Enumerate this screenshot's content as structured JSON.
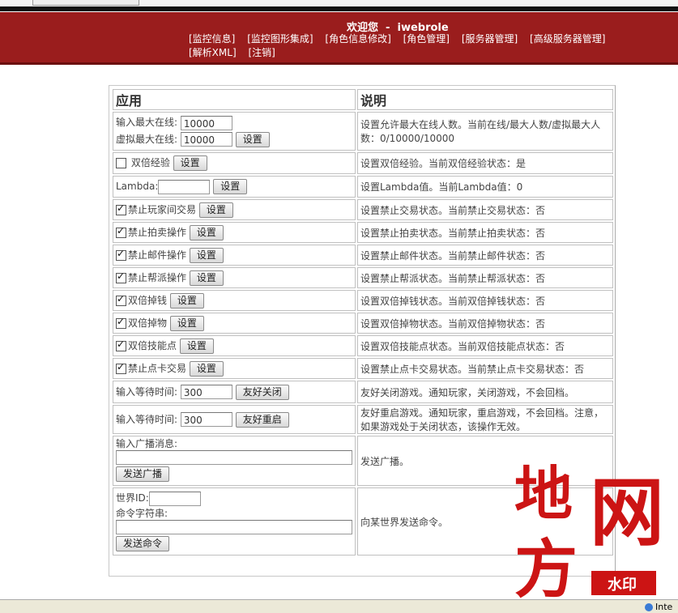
{
  "header": {
    "welcome": "欢迎您  -  iwebrole",
    "nav": [
      "[监控信息]",
      "[监控图形集成]",
      "[角色信息修改]",
      "[角色管理]",
      "[服务器管理]",
      "[高级服务器管理]",
      "[解析XML]",
      "[注销]"
    ]
  },
  "table": {
    "col_app": "应用",
    "col_desc": "说明",
    "rows": {
      "maxonline": {
        "label1": "输入最大在线:",
        "value1": "10000",
        "label2": "虚拟最大在线:",
        "value2": "10000",
        "button": "设置",
        "desc": "设置允许最大在线人数。当前在线/最大人数/虚拟最大人数：0/10000/10000"
      },
      "doubleexp": {
        "label": "双倍经验",
        "checked": false,
        "button": "设置",
        "desc": "设置双倍经验。当前双倍经验状态：是"
      },
      "lambda": {
        "label": "Lambda:",
        "value": "",
        "button": "设置",
        "desc": "设置Lambda值。当前Lambda值：0"
      },
      "notrade": {
        "label": "禁止玩家间交易",
        "checked": true,
        "button": "设置",
        "desc": "设置禁止交易状态。当前禁止交易状态：否"
      },
      "noauction": {
        "label": "禁止拍卖操作",
        "checked": true,
        "button": "设置",
        "desc": "设置禁止拍卖状态。当前禁止拍卖状态：否"
      },
      "nomail": {
        "label": "禁止邮件操作",
        "checked": true,
        "button": "设置",
        "desc": "设置禁止邮件状态。当前禁止邮件状态：否"
      },
      "noguild": {
        "label": "禁止帮派操作",
        "checked": true,
        "button": "设置",
        "desc": "设置禁止帮派状态。当前禁止帮派状态：否"
      },
      "doublemoney": {
        "label": "双倍掉钱",
        "checked": true,
        "button": "设置",
        "desc": "设置双倍掉钱状态。当前双倍掉钱状态：否"
      },
      "doubleitem": {
        "label": "双倍掉物",
        "checked": true,
        "button": "设置",
        "desc": "设置双倍掉物状态。当前双倍掉物状态：否"
      },
      "doubleskill": {
        "label": "双倍技能点",
        "checked": true,
        "button": "设置",
        "desc": "设置双倍技能点状态。当前双倍技能点状态：否"
      },
      "nocard": {
        "label": "禁止点卡交易",
        "checked": true,
        "button": "设置",
        "desc": "设置禁止点卡交易状态。当前禁止点卡交易状态：否"
      },
      "shutdown": {
        "label": "输入等待时间:",
        "value": "300",
        "button": "友好关闭",
        "desc": "友好关闭游戏。通知玩家，关闭游戏，不会回档。"
      },
      "restart": {
        "label": "输入等待时间:",
        "value": "300",
        "button": "友好重启",
        "desc": "友好重启游戏。通知玩家，重启游戏，不会回档。注意，如果游戏处于关闭状态，该操作无效。"
      },
      "broadcast": {
        "label": "输入广播消息:",
        "value": "",
        "button": "发送广播",
        "desc": "发送广播。"
      },
      "command": {
        "label1": "世界ID:",
        "value1": "",
        "label2": "命令字符串:",
        "value2": "",
        "button": "发送命令",
        "desc": "向某世界发送命令。"
      }
    }
  },
  "watermark": {
    "text1": "地",
    "text2": "网",
    "text3": "方",
    "badge": "水印"
  },
  "statusbar": {
    "zone": "Inte"
  }
}
